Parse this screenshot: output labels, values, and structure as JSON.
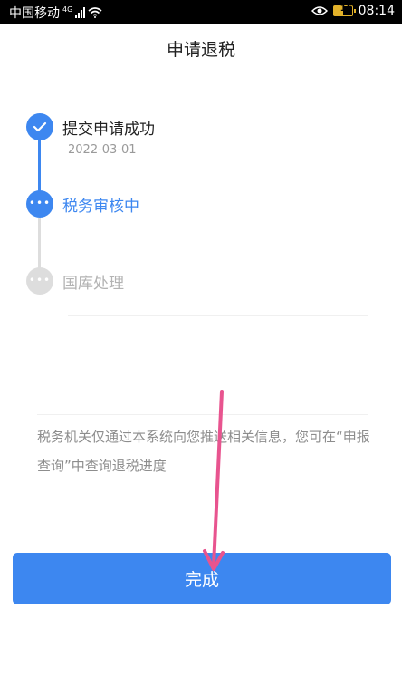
{
  "status_bar": {
    "carrier": "中国移动",
    "network": "4G",
    "battery": "15",
    "time": "08:14"
  },
  "header": {
    "title": "申请退税"
  },
  "timeline": {
    "steps": [
      {
        "title": "提交申请成功",
        "date": "2022-03-01",
        "state": "done",
        "icon": "check-icon"
      },
      {
        "title": "税务审核中",
        "state": "active",
        "icon": "ellipsis-icon"
      },
      {
        "title": "国库处理",
        "state": "pending",
        "icon": "ellipsis-icon"
      }
    ],
    "colors": {
      "active": "#3d87f0",
      "pending": "#dddddd",
      "pending_text": "#b3b3b3",
      "done_text": "#222222"
    }
  },
  "notice": {
    "text": "税务机关仅通过本系统向您推送相关信息，您可在“申报查询”中查询退税进度"
  },
  "actions": {
    "finish_label": "完成"
  },
  "annotation": {
    "arrow_color": "#e8548f"
  }
}
